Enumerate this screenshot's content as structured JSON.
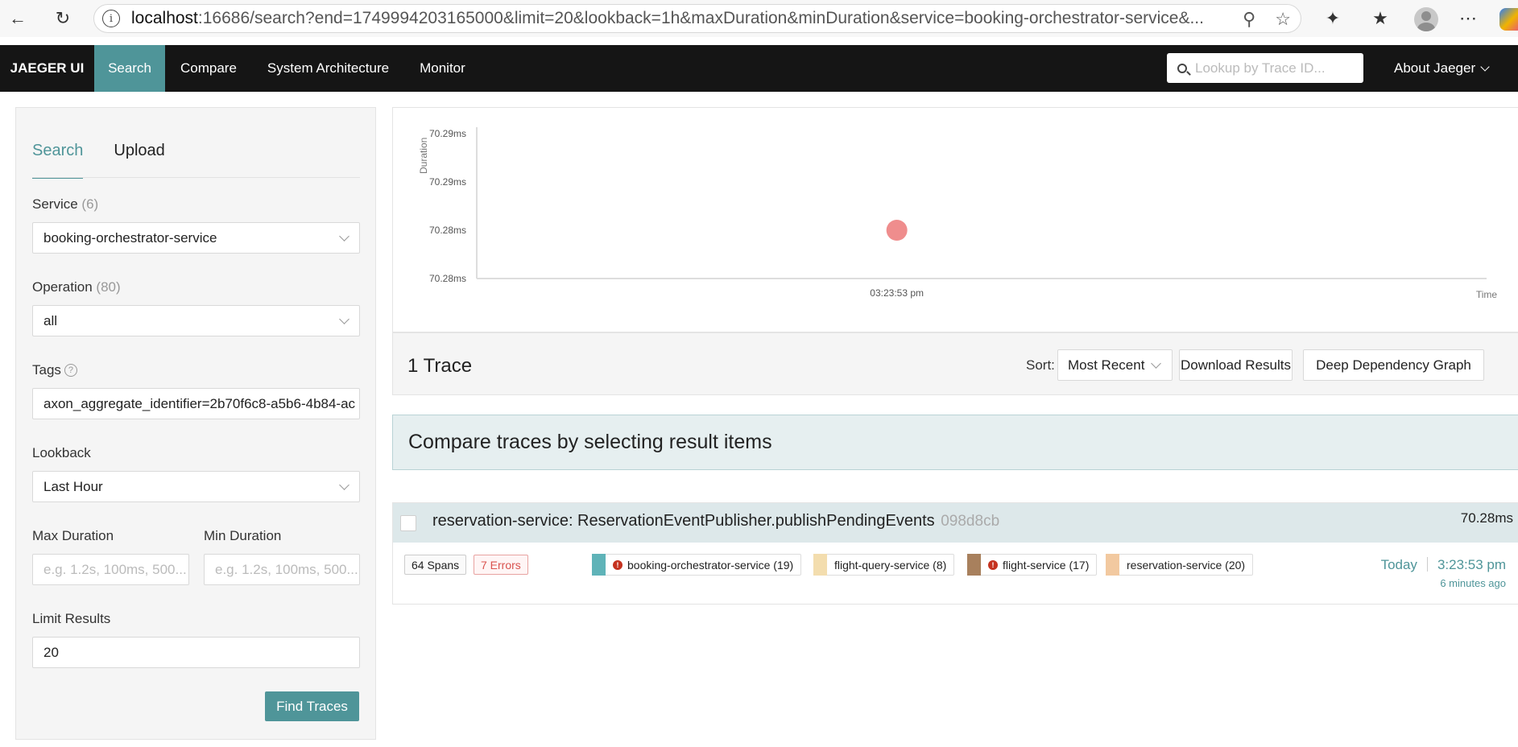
{
  "browser": {
    "url_host": "localhost",
    "url_rest": ":16686/search?end=1749994203165000&limit=20&lookback=1h&maxDuration&minDuration&service=booking-orchestrator-service&..."
  },
  "topnav": {
    "brand": "JAEGER UI",
    "items": [
      "Search",
      "Compare",
      "System Architecture",
      "Monitor"
    ],
    "lookup_placeholder": "Lookup by Trace ID...",
    "about": "About Jaeger"
  },
  "search_form": {
    "tabs": [
      "Search",
      "Upload"
    ],
    "service_label": "Service",
    "service_count": "(6)",
    "service_value": "booking-orchestrator-service",
    "operation_label": "Operation",
    "operation_count": "(80)",
    "operation_value": "all",
    "tags_label": "Tags",
    "tags_value": "axon_aggregate_identifier=2b70f6c8-a5b6-4b84-ac",
    "lookback_label": "Lookback",
    "lookback_value": "Last Hour",
    "max_duration_label": "Max Duration",
    "max_duration_placeholder": "e.g. 1.2s, 100ms, 500...",
    "min_duration_label": "Min Duration",
    "min_duration_placeholder": "e.g. 1.2s, 100ms, 500...",
    "limit_label": "Limit Results",
    "limit_value": "20",
    "find_button": "Find Traces"
  },
  "chart_data": {
    "type": "scatter",
    "ylabel": "Duration",
    "xlabel": "Time",
    "y_ticks": [
      "70.29ms",
      "70.29ms",
      "70.28ms",
      "70.28ms"
    ],
    "x_ticks": [
      "03:23:53 pm"
    ],
    "points": [
      {
        "x": "03:23:53 pm",
        "y": 70.28
      }
    ],
    "point_color": "#ef8d8d"
  },
  "results": {
    "count_text": "1 Trace",
    "sort_label": "Sort:",
    "sort_value": "Most Recent",
    "download_button": "Download Results",
    "ddg_button": "Deep Dependency Graph",
    "compare_banner": "Compare traces by selecting result items"
  },
  "trace": {
    "title": "reservation-service: ReservationEventPublisher.publishPendingEvents",
    "id": "098d8cb",
    "duration": "70.28ms",
    "spans": "64 Spans",
    "errors": "7 Errors",
    "services": [
      {
        "name": "booking-orchestrator-service (19)",
        "color": "#5fb3b8",
        "error": true
      },
      {
        "name": "flight-query-service (8)",
        "color": "#f3ddae",
        "error": false
      },
      {
        "name": "flight-service (17)",
        "color": "#a8805d",
        "error": true
      },
      {
        "name": "reservation-service (20)",
        "color": "#f2c9a0",
        "error": false
      }
    ],
    "day": "Today",
    "time": "3:23:53 pm",
    "ago": "6 minutes ago"
  }
}
